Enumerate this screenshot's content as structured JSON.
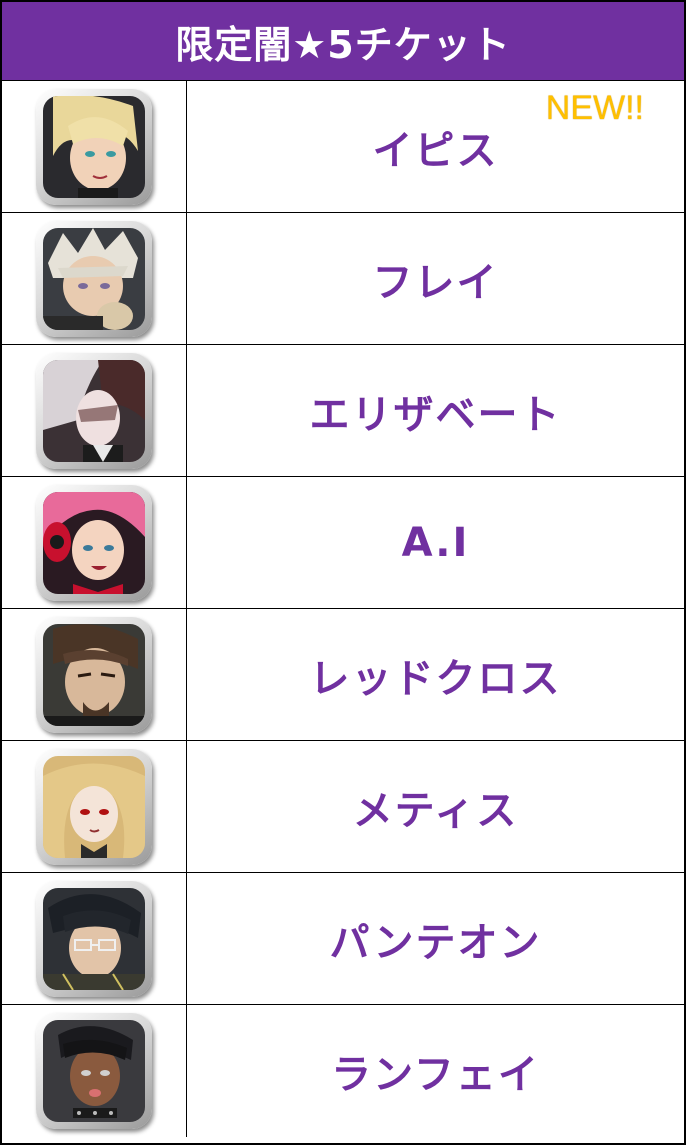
{
  "title": "限定闇★5チケット",
  "rows": [
    {
      "name": "イピス",
      "icon": "character-portrait-ipis",
      "badge": "NEW!!"
    },
    {
      "name": "フレイ",
      "icon": "character-portrait-frey"
    },
    {
      "name": "エリザベート",
      "icon": "character-portrait-elizabeth"
    },
    {
      "name": "A.I",
      "icon": "character-portrait-ai"
    },
    {
      "name": "レッドクロス",
      "icon": "character-portrait-redcross"
    },
    {
      "name": "メティス",
      "icon": "character-portrait-metis"
    },
    {
      "name": "パンテオン",
      "icon": "character-portrait-pantheon"
    },
    {
      "name": "ランフェイ",
      "icon": "character-portrait-lanfei"
    }
  ],
  "colors": {
    "header_bg": "#7030a0",
    "name_text": "#7030a0",
    "badge": "#ffc000"
  }
}
